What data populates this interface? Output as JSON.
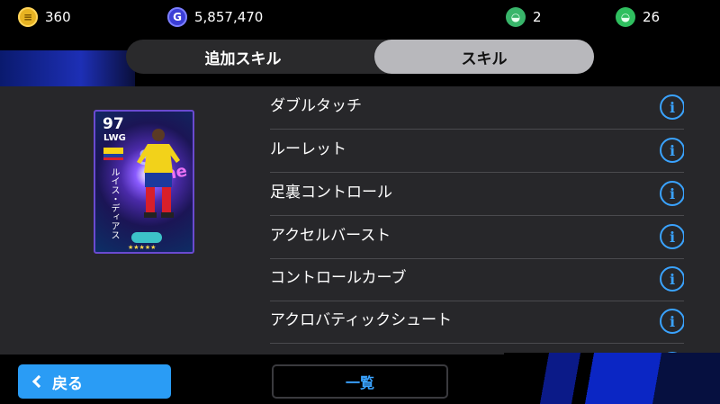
{
  "currencies": {
    "coins": "360",
    "gp": "5,857,470",
    "ticket_a": "2",
    "ticket_b": "26"
  },
  "currency_icons": {
    "coins": "coin-icon",
    "gp": "gp-icon",
    "ticket_a": "ticket-icon",
    "ticket_b": "ticket-icon"
  },
  "tabs": [
    {
      "label": "追加スキル",
      "active": false
    },
    {
      "label": "スキル",
      "active": true
    }
  ],
  "player_card": {
    "rating": "97",
    "position": "LWG",
    "name_vertical": "ルイス・ディアス"
  },
  "skills": [
    "ダブルタッチ",
    "ルーレット",
    "足裏コントロール",
    "アクセルバースト",
    "コントロールカーブ",
    "アクロバティックシュート",
    ""
  ],
  "footer": {
    "back_label": "戻る",
    "list_label": "一覧"
  },
  "colors": {
    "accent_blue": "#2a9cf5",
    "info_blue": "#3aa3ff",
    "active_tab": "#b8b8bc"
  }
}
